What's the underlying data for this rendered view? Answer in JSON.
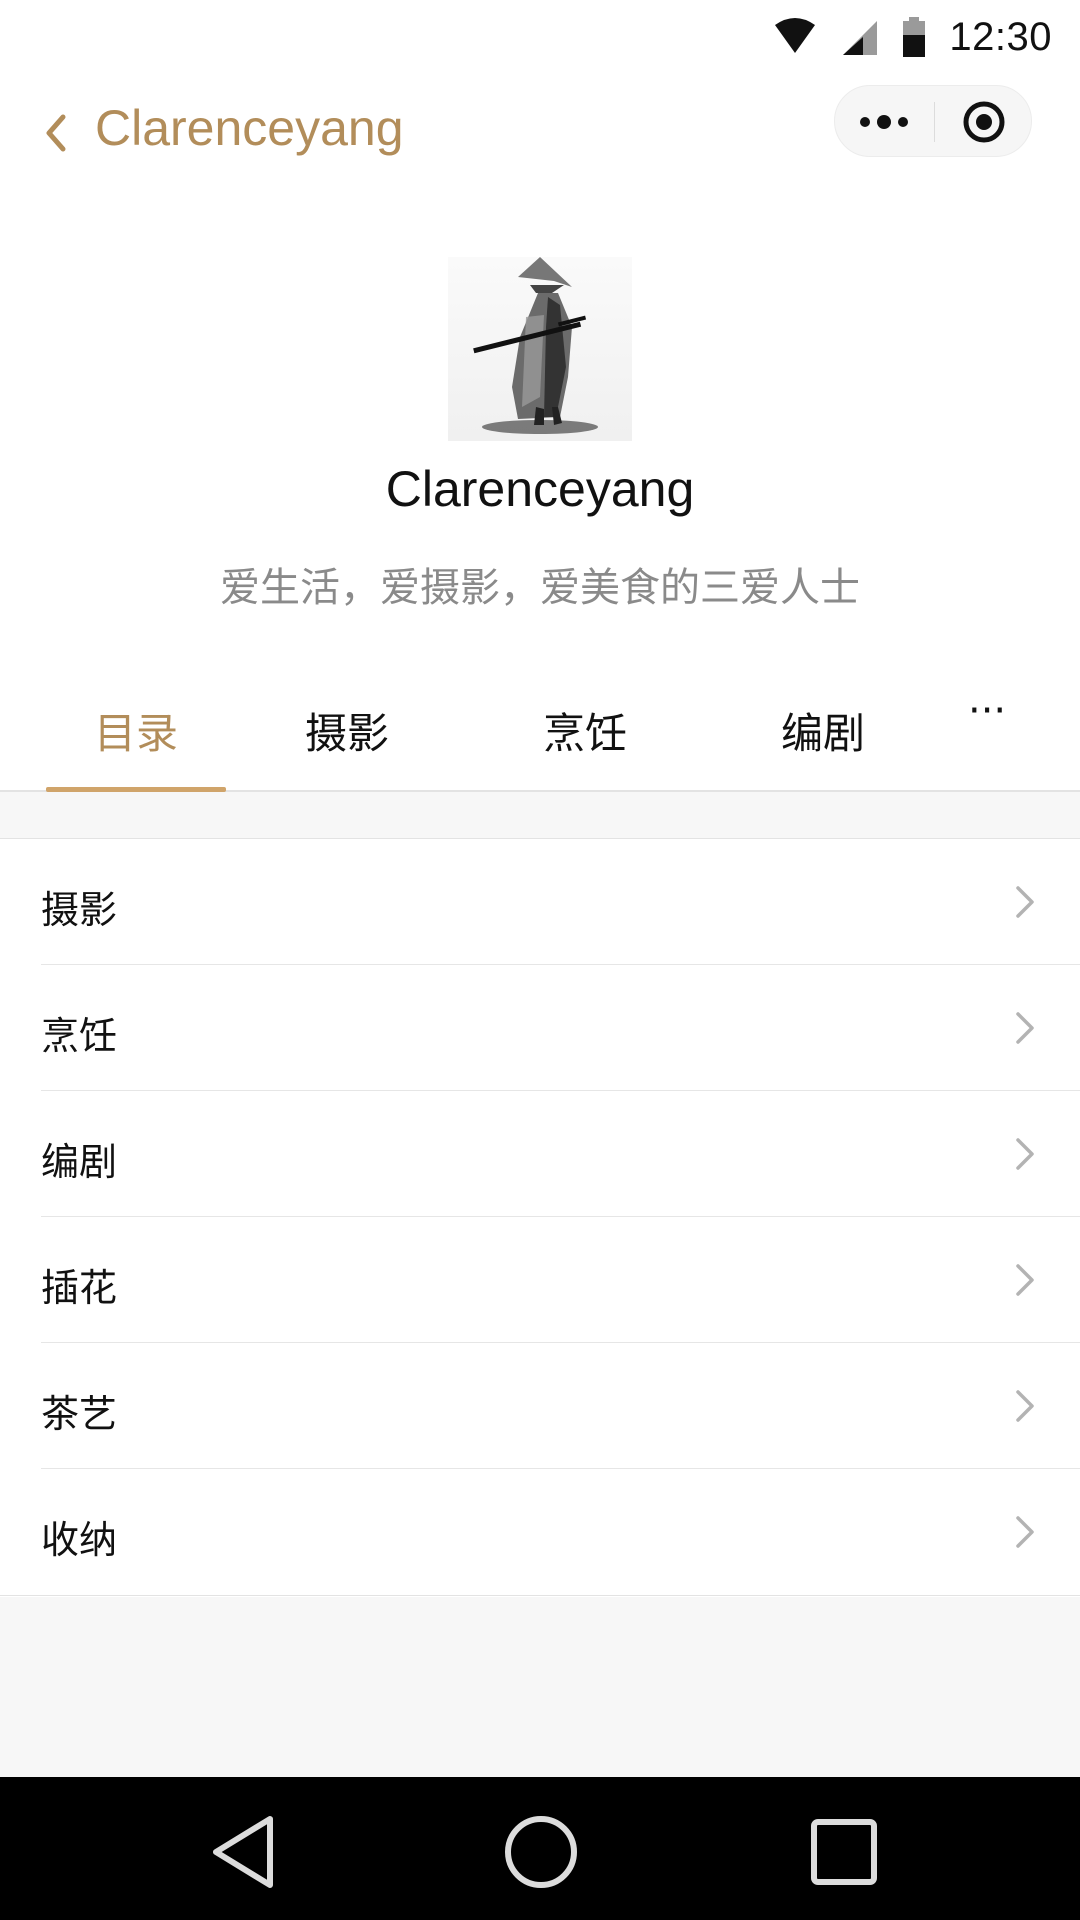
{
  "status": {
    "time": "12:30"
  },
  "nav": {
    "title": "Clarenceyang"
  },
  "profile": {
    "name": "Clarenceyang",
    "bio": "爱生活，爱摄影，爱美食的三爱人士"
  },
  "tabs": [
    {
      "label": "目录",
      "active": true
    },
    {
      "label": "摄影"
    },
    {
      "label": "烹饪"
    },
    {
      "label": "编剧"
    }
  ],
  "tabs_more": "···",
  "list": [
    {
      "label": "摄影"
    },
    {
      "label": "烹饪"
    },
    {
      "label": "编剧"
    },
    {
      "label": "插花"
    },
    {
      "label": "茶艺"
    },
    {
      "label": "收纳"
    }
  ],
  "colors": {
    "accent": "#b28d5a",
    "indicator": "#d0a46a"
  }
}
